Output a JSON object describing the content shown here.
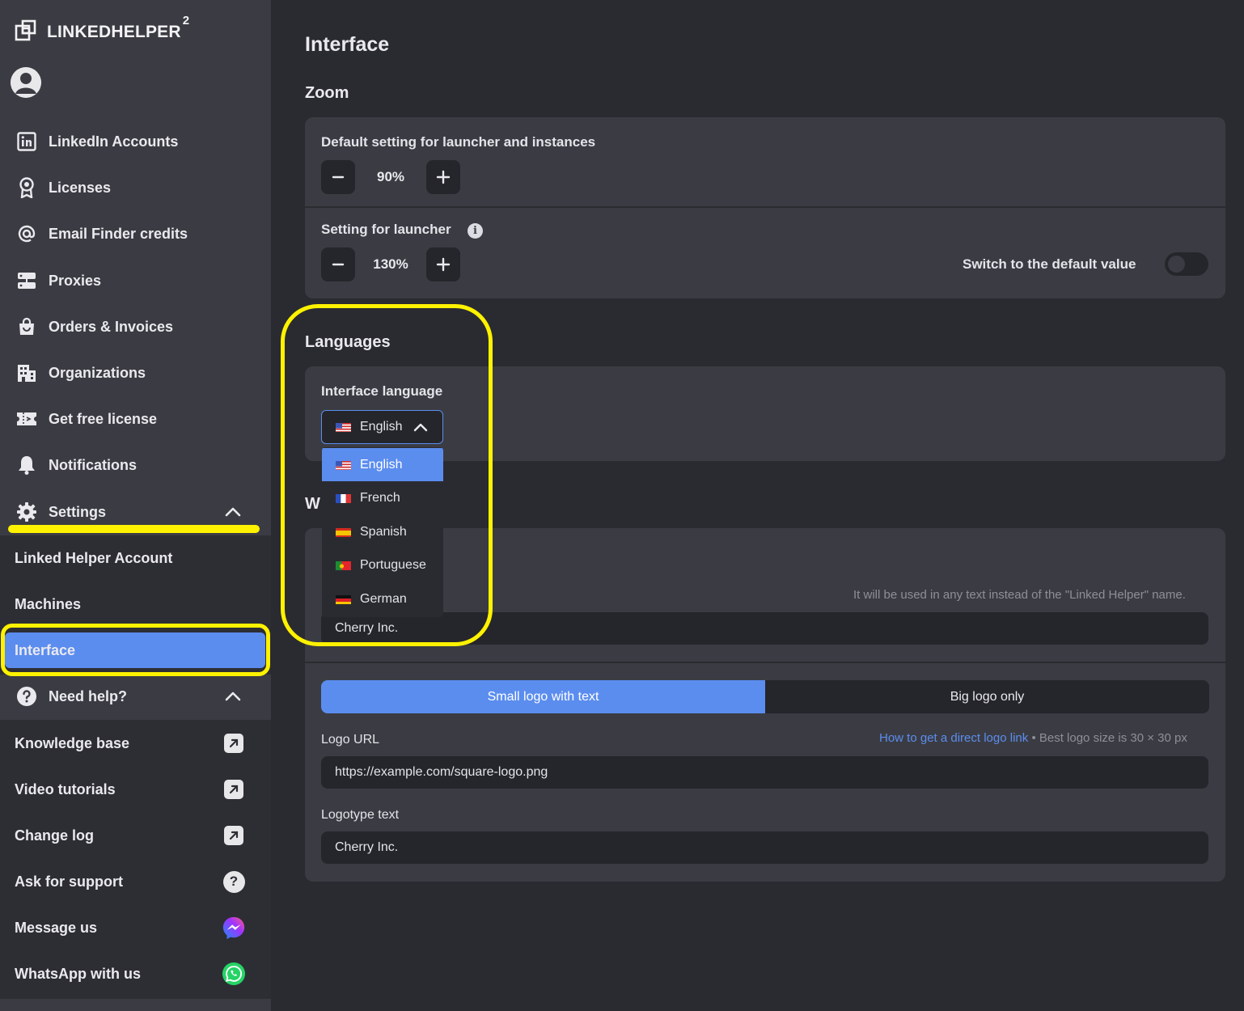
{
  "brand": {
    "name": "LINKEDHELPER",
    "superscript": "2"
  },
  "sidebar": {
    "items": [
      {
        "label": "LinkedIn Accounts",
        "icon": "linkedin-icon"
      },
      {
        "label": "Licenses",
        "icon": "award-icon"
      },
      {
        "label": "Email Finder credits",
        "icon": "at-icon"
      },
      {
        "label": "Proxies",
        "icon": "server-icon"
      },
      {
        "label": "Orders & Invoices",
        "icon": "shopping-bag-icon"
      },
      {
        "label": "Organizations",
        "icon": "building-icon"
      },
      {
        "label": "Get free license",
        "icon": "ticket-icon"
      },
      {
        "label": "Notifications",
        "icon": "bell-icon"
      },
      {
        "label": "Settings",
        "icon": "gear-icon"
      }
    ],
    "settings_sub": [
      {
        "label": "Linked Helper Account"
      },
      {
        "label": "Machines"
      },
      {
        "label": "Interface",
        "active": true
      }
    ],
    "help": {
      "label": "Need help?",
      "icon": "question-circle-icon"
    },
    "help_sub": [
      {
        "label": "Knowledge base",
        "icon": "external-link-icon"
      },
      {
        "label": "Video tutorials",
        "icon": "external-link-icon"
      },
      {
        "label": "Change log",
        "icon": "external-link-icon"
      },
      {
        "label": "Ask for support",
        "icon": "question-icon"
      },
      {
        "label": "Message us",
        "icon": "messenger-icon"
      },
      {
        "label": "WhatsApp with us",
        "icon": "whatsapp-icon"
      }
    ]
  },
  "main": {
    "title": "Interface",
    "zoom": {
      "title": "Zoom",
      "default_label": "Default setting for launcher and instances",
      "default_value": "90%",
      "launcher_label": "Setting for launcher",
      "launcher_value": "130%",
      "switch_label": "Switch to the default value"
    },
    "languages": {
      "title": "Languages",
      "field_label": "Interface language",
      "selected": "English",
      "options": [
        "English",
        "French",
        "Spanish",
        "Portuguese",
        "German"
      ]
    },
    "whitelabel": {
      "title_partial": "W",
      "name_hint": "It will be used in any text instead of the \"Linked Helper\" name.",
      "name_value": "Cherry Inc.",
      "logo_modes": [
        "Small logo with text",
        "Big logo only"
      ],
      "logo_url_label": "Logo URL",
      "logo_link_text": "How to get a direct logo link",
      "logo_size_hint": "• Best logo size is 30 × 30 px",
      "logo_url_value": "https://example.com/square-logo.png",
      "logotype_label": "Logotype text",
      "logotype_value": "Cherry Inc."
    }
  },
  "colors": {
    "accent": "#5b8def",
    "highlight": "#fff200",
    "sidebar_bg": "#3b3c43",
    "page_bg": "#2a2b31"
  }
}
